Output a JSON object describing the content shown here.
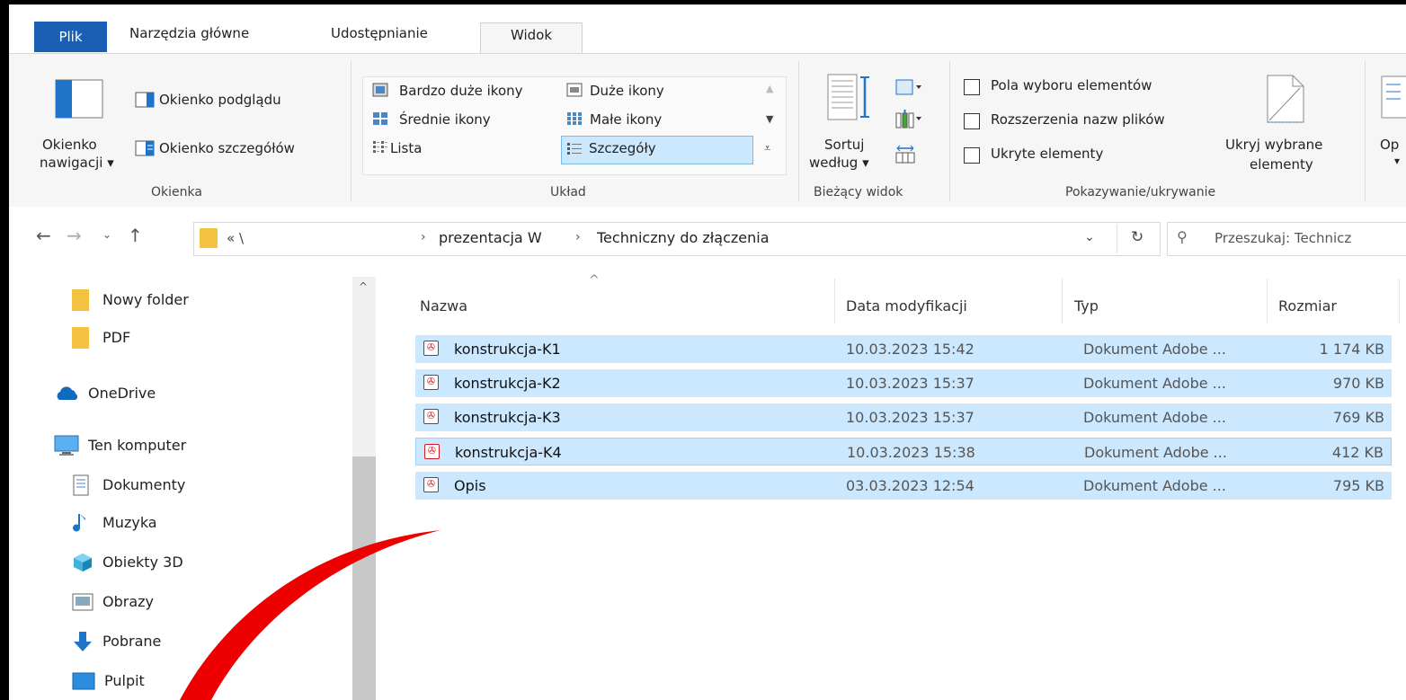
{
  "tabs": [
    "Plik",
    "Narzędzia główne",
    "Udostępnianie",
    "Widok"
  ],
  "ribbon": {
    "panes": {
      "nav_pane_line1": "Okienko",
      "nav_pane_line2": "nawigacji",
      "preview_pane": "Okienko podglądu",
      "details_pane": "Okienko szczegółów",
      "group_label": "Okienka"
    },
    "layout": {
      "very_large": "Bardzo duże ikony",
      "large": "Duże ikony",
      "medium": "Średnie ikony",
      "small": "Małe ikony",
      "list": "Lista",
      "details": "Szczegóły",
      "group_label": "Układ"
    },
    "current_view": {
      "sort_line1": "Sortuj",
      "sort_line2": "według",
      "group_label": "Bieżący widok"
    },
    "show_hide": {
      "item_checkboxes": "Pola wyboru elementów",
      "file_extensions": "Rozszerzenia nazw plików",
      "hidden_items": "Ukryte elementy",
      "hide_selected_line1": "Ukryj wybrane",
      "hide_selected_line2": "elementy",
      "group_label": "Pokazywanie/ukrywanie"
    },
    "options_partial": "Op"
  },
  "address": {
    "prefix": "«  \\",
    "crumb1": "prezentacja W",
    "crumb2": "Techniczny do złączenia",
    "search_placeholder": "Przeszukaj: Technicz"
  },
  "nav_pane": [
    "Nowy folder",
    "PDF",
    "OneDrive",
    "Ten komputer",
    "Dokumenty",
    "Muzyka",
    "Obiekty 3D",
    "Obrazy",
    "Pobrane",
    "Pulpit"
  ],
  "columns": [
    "Nazwa",
    "Data modyfikacji",
    "Typ",
    "Rozmiar"
  ],
  "files": [
    {
      "name": "konstrukcja-K1",
      "date": "10.03.2023 15:42",
      "type": "Dokument Adobe ...",
      "size": "1 174 KB"
    },
    {
      "name": "konstrukcja-K2",
      "date": "10.03.2023 15:37",
      "type": "Dokument Adobe ...",
      "size": "970 KB"
    },
    {
      "name": "konstrukcja-K3",
      "date": "10.03.2023 15:37",
      "type": "Dokument Adobe ...",
      "size": "769 KB"
    },
    {
      "name": "konstrukcja-K4",
      "date": "10.03.2023 15:38",
      "type": "Dokument Adobe ...",
      "size": "412 KB"
    },
    {
      "name": "Opis",
      "date": "03.03.2023 12:54",
      "type": "Dokument Adobe ...",
      "size": "795 KB"
    }
  ],
  "colors": {
    "accent": "#1a5fb4",
    "selection": "#cce8ff",
    "annotation_arrow": "#ee0000"
  }
}
